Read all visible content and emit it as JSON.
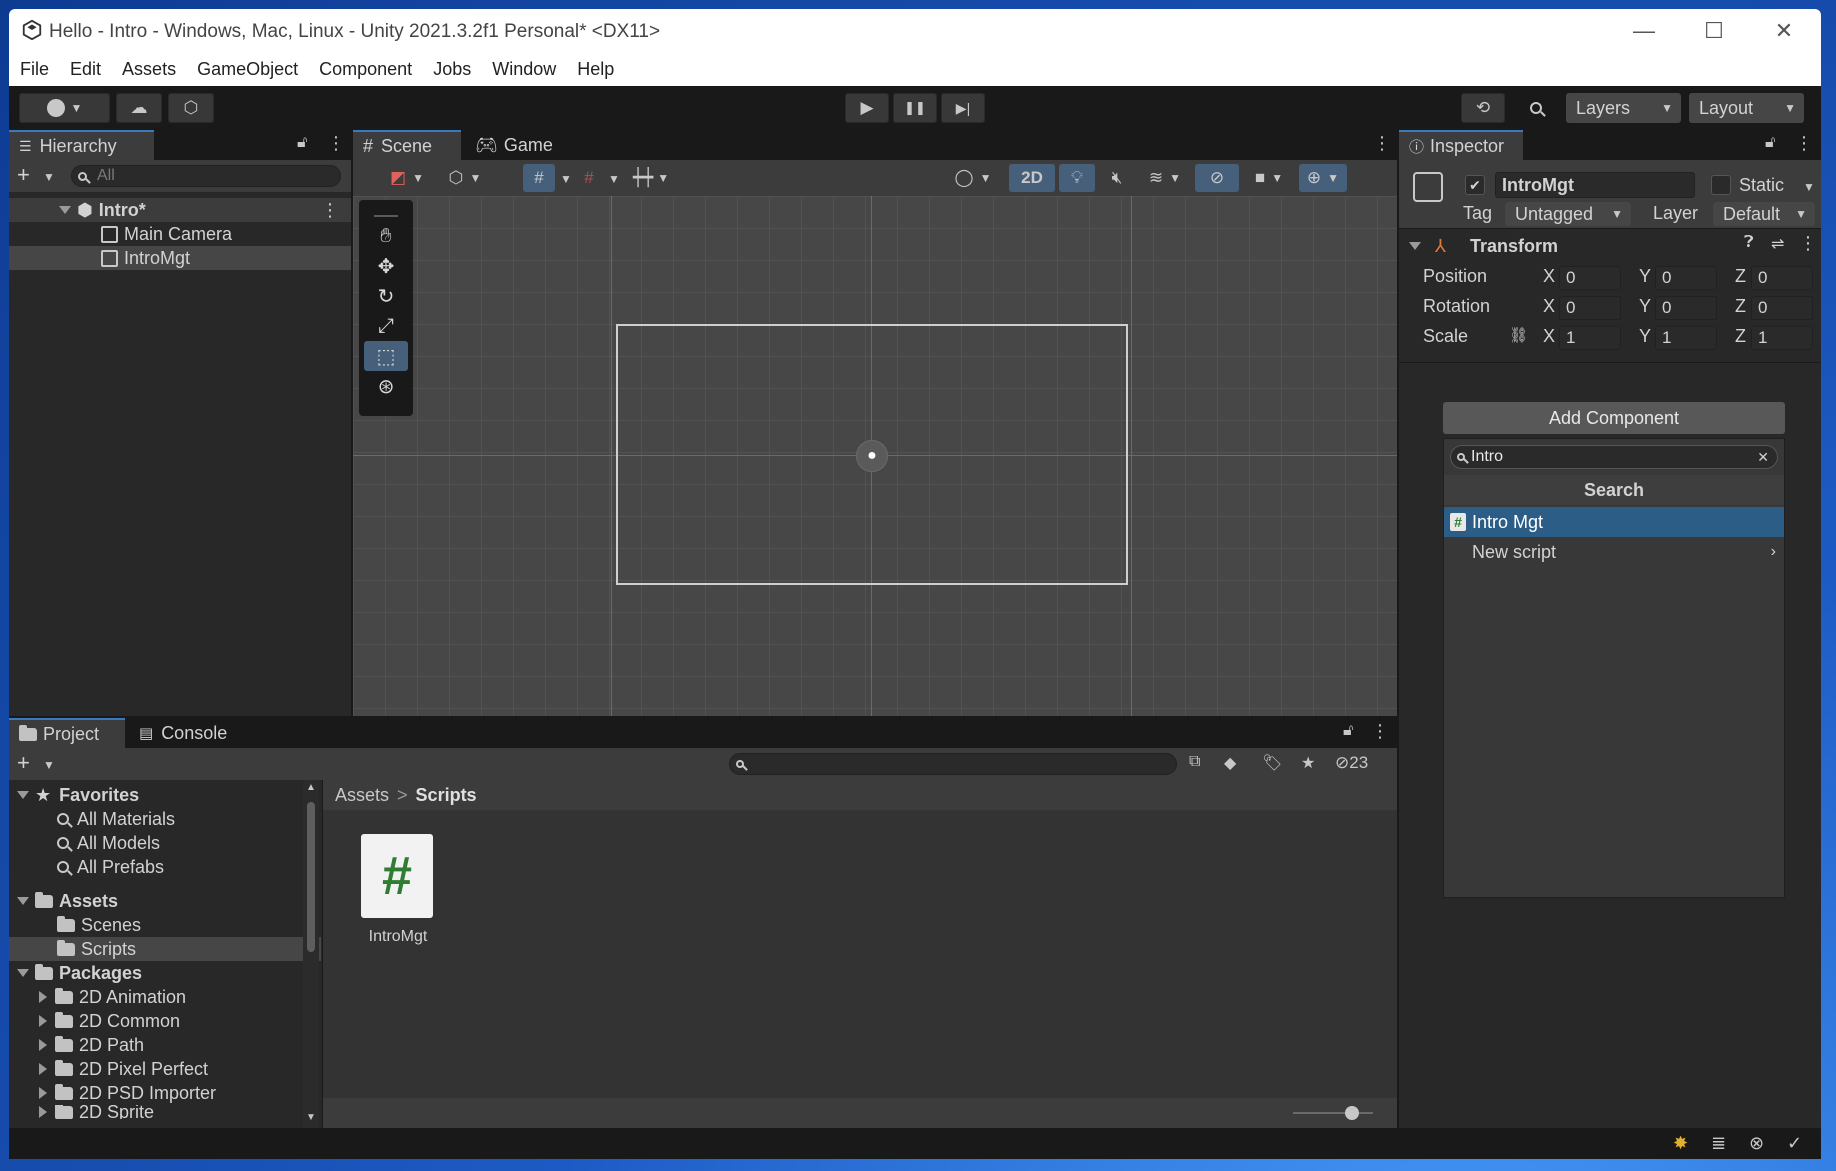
{
  "window": {
    "title": "Hello - Intro - Windows, Mac, Linux - Unity 2021.3.2f1 Personal* <DX11>",
    "minimize": "—",
    "maximize": "☐",
    "close": "✕"
  },
  "menu": [
    "File",
    "Edit",
    "Assets",
    "GameObject",
    "Component",
    "Jobs",
    "Window",
    "Help"
  ],
  "toolbar": {
    "account_icon": "account-icon",
    "cloud_icon": "cloud-icon",
    "collab_icon": "collab-icon",
    "play": "▶",
    "pause": "❚❚",
    "step": "▶|",
    "layers_label": "Layers",
    "layout_label": "Layout"
  },
  "hierarchy": {
    "tab": "Hierarchy",
    "search_placeholder": "All",
    "scene": "Intro*",
    "items": [
      "Main Camera",
      "IntroMgt"
    ]
  },
  "scene_view": {
    "tabs": [
      "Scene",
      "Game"
    ],
    "toggle_2d": "2D"
  },
  "inspector": {
    "tab": "Inspector",
    "object_name": "IntroMgt",
    "static_label": "Static",
    "tag_label": "Tag",
    "tag_value": "Untagged",
    "layer_label": "Layer",
    "layer_value": "Default",
    "transform_title": "Transform",
    "rows": [
      {
        "label": "Position",
        "x": "0",
        "y": "0",
        "z": "0"
      },
      {
        "label": "Rotation",
        "x": "0",
        "y": "0",
        "z": "0"
      },
      {
        "label": "Scale",
        "x": "1",
        "y": "1",
        "z": "1"
      }
    ],
    "axis_x": "X",
    "axis_y": "Y",
    "axis_z": "Z",
    "add_component": "Add Component",
    "search_value": "Intro",
    "search_header": "Search",
    "results": [
      "Intro Mgt",
      "New script"
    ]
  },
  "project": {
    "tabs": [
      "Project",
      "Console"
    ],
    "favorites_label": "Favorites",
    "favorites": [
      "All Materials",
      "All Models",
      "All Prefabs"
    ],
    "assets_label": "Assets",
    "asset_folders": [
      "Scenes",
      "Scripts"
    ],
    "packages_label": "Packages",
    "packages": [
      "2D Animation",
      "2D Common",
      "2D Path",
      "2D Pixel Perfect",
      "2D PSD Importer",
      "2D Sprite"
    ],
    "breadcrumb": [
      "Assets",
      "Scripts"
    ],
    "breadcrumb_sep": ">",
    "hidden_count": "23",
    "file_name": "IntroMgt",
    "file_glyph": "#"
  },
  "colors": {
    "accent": "#2c5d87",
    "selected_row": "#2c5d87",
    "script_green": "#2e7d32"
  }
}
